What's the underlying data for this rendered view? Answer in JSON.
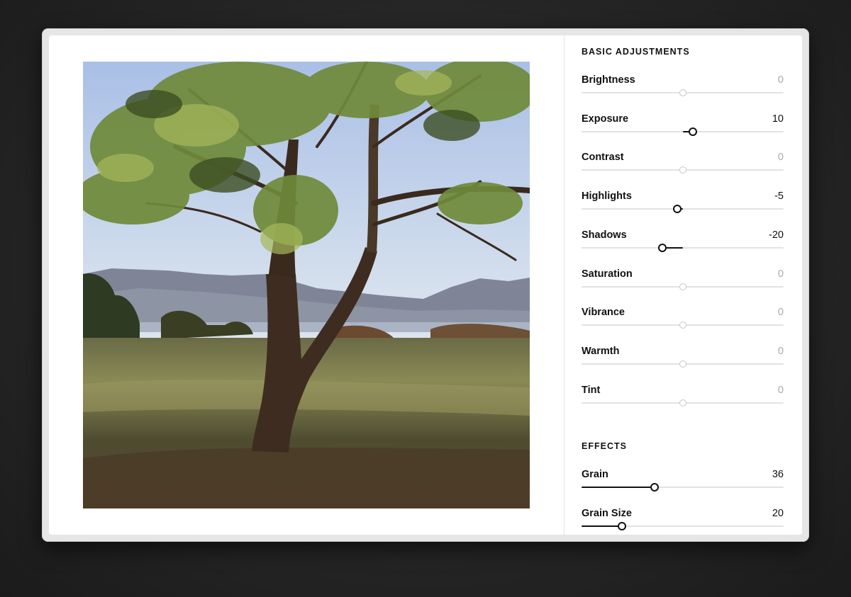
{
  "panel": {
    "basic_title": "BASIC ADJUSTMENTS",
    "effects_title": "EFFECTS"
  },
  "adjustments": [
    {
      "id": "brightness",
      "label": "Brightness",
      "value": "0",
      "level": 0,
      "min": -100,
      "max": 100
    },
    {
      "id": "exposure",
      "label": "Exposure",
      "value": "10",
      "level": 10,
      "min": -100,
      "max": 100
    },
    {
      "id": "contrast",
      "label": "Contrast",
      "value": "0",
      "level": 0,
      "min": -100,
      "max": 100
    },
    {
      "id": "highlights",
      "label": "Highlights",
      "value": "-5",
      "level": -5,
      "min": -100,
      "max": 100
    },
    {
      "id": "shadows",
      "label": "Shadows",
      "value": "-20",
      "level": -20,
      "min": -100,
      "max": 100
    },
    {
      "id": "saturation",
      "label": "Saturation",
      "value": "0",
      "level": 0,
      "min": -100,
      "max": 100
    },
    {
      "id": "vibrance",
      "label": "Vibrance",
      "value": "0",
      "level": 0,
      "min": -100,
      "max": 100
    },
    {
      "id": "warmth",
      "label": "Warmth",
      "value": "0",
      "level": 0,
      "min": -100,
      "max": 100
    },
    {
      "id": "tint",
      "label": "Tint",
      "value": "0",
      "level": 0,
      "min": -100,
      "max": 100
    }
  ],
  "effects": [
    {
      "id": "grain",
      "label": "Grain",
      "value": "36",
      "level": 36,
      "min": 0,
      "max": 100
    },
    {
      "id": "grain_size",
      "label": "Grain Size",
      "value": "20",
      "level": 20,
      "min": 0,
      "max": 100
    }
  ],
  "colors": {
    "accent": "#111111",
    "track": "#e2e2e2",
    "muted": "#a8a8a8"
  }
}
